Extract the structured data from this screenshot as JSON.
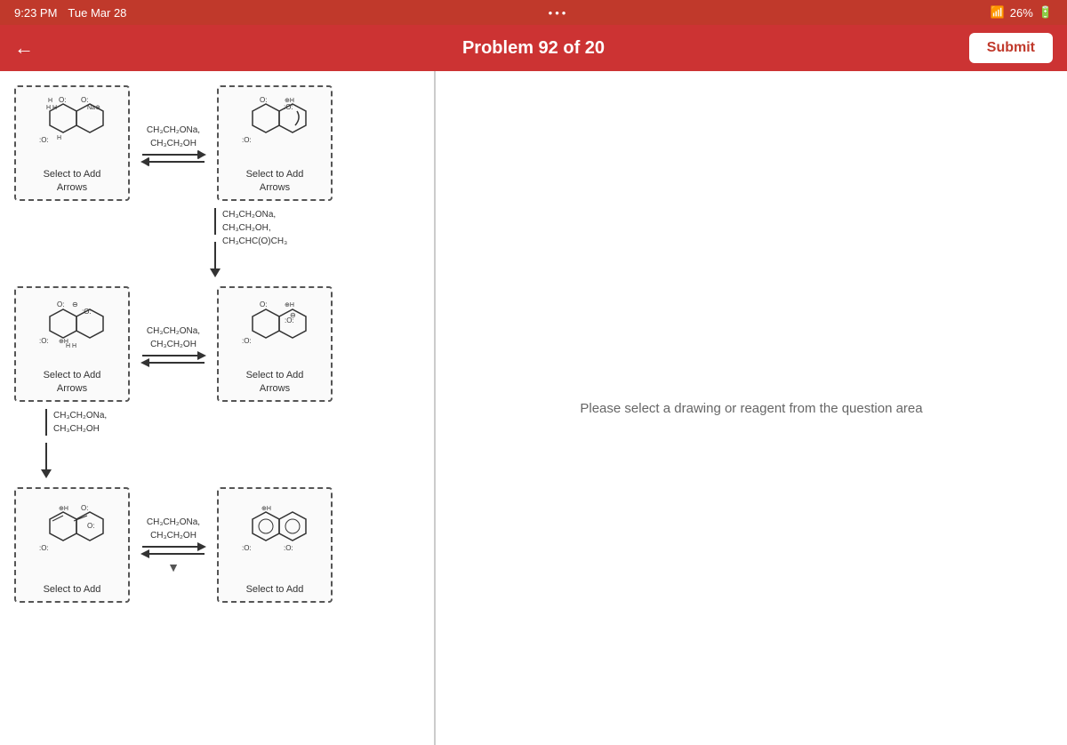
{
  "statusBar": {
    "time": "9:23 PM",
    "date": "Tue Mar 28",
    "dots": "...",
    "wifi": "26%",
    "battery": "▓"
  },
  "header": {
    "title": "Problem 92 of 20",
    "backIcon": "←",
    "submitLabel": "Submit"
  },
  "answerPanel": {
    "placeholder": "Please select a drawing or reagent from the question area"
  },
  "reactions": [
    {
      "id": "row1",
      "left": {
        "label": "Select to Add\nArrows"
      },
      "reagent": "CH₃CH₂ONa,\nCH₃CH₂OH",
      "right": {
        "label": "Select to Add\nArrows"
      }
    },
    {
      "id": "row2-vertical",
      "reagent": "CH₃CH₂ONa,\nCH₃CH₂OH,\nCH₃CHC(O)CH₃"
    },
    {
      "id": "row3",
      "left": {
        "label": "Select to Add\nArrows"
      },
      "reagent": "CH₃CH₂ONa,\nCH₃CH₂OH",
      "right": {
        "label": "Select to Add\nArrows"
      }
    },
    {
      "id": "row4-vertical",
      "reagent": "CH₃CH₂ONa,\nCH₃CH₂OH"
    },
    {
      "id": "row5",
      "left": {
        "label": "Select to Add"
      },
      "reagent": "CH₃CH₂ONa,\nCH₃CH₂OH",
      "right": {
        "label": "Select to Add"
      }
    }
  ]
}
